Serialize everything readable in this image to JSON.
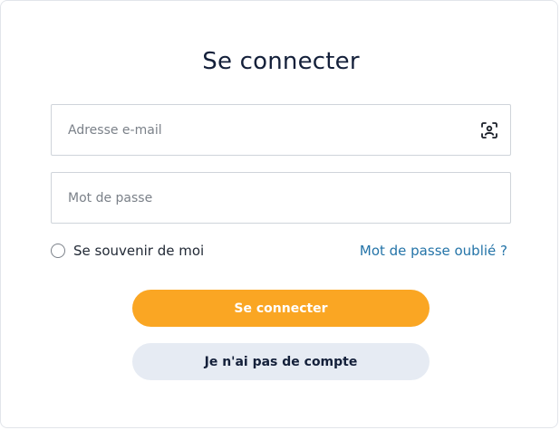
{
  "login": {
    "title": "Se connecter",
    "email_placeholder": "Adresse e-mail",
    "password_placeholder": "Mot de passe",
    "remember_label": "Se souvenir de moi",
    "forgot_link": "Mot de passe oublié ?",
    "submit_label": "Se connecter",
    "no_account_label": "Je n'ai pas de compte"
  },
  "icons": {
    "email_field_icon": "face-scan-icon"
  },
  "colors": {
    "primary_button": "#faa623",
    "secondary_button": "#e6ebf3",
    "link": "#2474a8",
    "title": "#14203a"
  }
}
